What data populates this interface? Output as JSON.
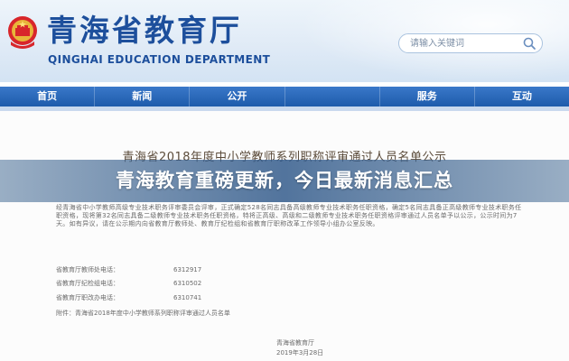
{
  "header": {
    "title_cn": "青海省教育厅",
    "title_en": "QINGHAI EDUCATION DEPARTMENT",
    "emblem_icon": "national-emblem-icon"
  },
  "search": {
    "placeholder": "请输入关键词",
    "button_icon": "search-icon"
  },
  "nav": {
    "items": [
      {
        "label": "首页"
      },
      {
        "label": "新闻"
      },
      {
        "label": "公开"
      },
      {
        "label": ""
      },
      {
        "label": "服务"
      },
      {
        "label": "互动"
      }
    ]
  },
  "document": {
    "title": "青海省2018年度中小学教师系列职称评审通过人员名单公示",
    "paragraph_1": "经青海省中小学教师高级专业技术职务评审委员会评审，正式确定528名同志具备高级教师专业技术职务任职资格，确定5名同志具备正高级教师专业技术职务任职资格，现将第32名同志具备二级教师专业技术职务任职资格，特将正高级、高级和二级教师专业技术职务任职资格评审通过人员名单予以公示，公示时间为7天。如有异议，请在公示期内向省教育厅教师处、教育厅纪检组和省教育厅职称改革工作领导小组办公室反映。",
    "contacts": [
      {
        "label": "省教育厅教师处电话：",
        "number": "6312917"
      },
      {
        "label": "省教育厅纪检组电话：",
        "number": "6310502"
      },
      {
        "label": "省教育厅职改办电话：",
        "number": "6310741"
      }
    ],
    "attachment": "附件：青海省2018年度中小学教师系列职称评审通过人员名单",
    "signature_org": "青海省教育厅",
    "signature_date": "2019年3月28日"
  },
  "banner": {
    "text": "青海教育重磅更新，今日最新消息汇总"
  },
  "colors": {
    "brand_blue": "#1d4f9c",
    "nav_blue": "#2a69bb"
  }
}
